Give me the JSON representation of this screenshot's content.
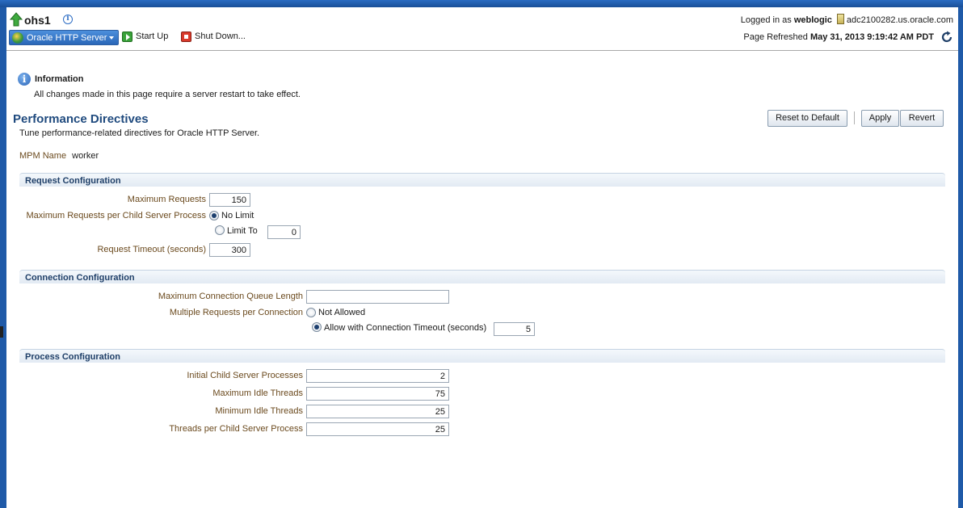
{
  "header": {
    "target_name": "ohs1",
    "target_menu_label": "Oracle HTTP Server",
    "start_up_label": "Start Up",
    "shut_down_label": "Shut Down...",
    "logged_in_label": "Logged in as",
    "user": "weblogic",
    "host": "adc2100282.us.oracle.com",
    "page_refreshed_label": "Page Refreshed",
    "page_refreshed_time": "May 31, 2013 9:19:42 AM PDT"
  },
  "info": {
    "title": "Information",
    "message": "All changes made in this page require a server restart to take effect."
  },
  "page": {
    "title": "Performance Directives",
    "subtitle": "Tune performance-related directives for Oracle HTTP Server.",
    "mpm_label": "MPM Name",
    "mpm_value": "worker",
    "reset_label": "Reset to Default",
    "apply_label": "Apply",
    "revert_label": "Revert"
  },
  "request_config": {
    "title": "Request Configuration",
    "max_requests_label": "Maximum Requests",
    "max_requests_value": "150",
    "max_per_child_label": "Maximum Requests per Child Server Process",
    "no_limit_label": "No Limit",
    "limit_to_label": "Limit To",
    "limit_to_value": "0",
    "timeout_label": "Request Timeout (seconds)",
    "timeout_value": "300"
  },
  "connection_config": {
    "title": "Connection Configuration",
    "queue_length_label": "Maximum Connection Queue Length",
    "queue_length_value": "",
    "multi_requests_label": "Multiple Requests per Connection",
    "not_allowed_label": "Not Allowed",
    "allow_label": "Allow with Connection Timeout (seconds)",
    "allow_value": "5"
  },
  "process_config": {
    "title": "Process Configuration",
    "rows": [
      {
        "label": "Initial Child Server Processes",
        "value": "2"
      },
      {
        "label": "Maximum Idle Threads",
        "value": "75"
      },
      {
        "label": "Minimum Idle Threads",
        "value": "25"
      },
      {
        "label": "Threads per Child Server Process",
        "value": "25"
      }
    ]
  }
}
